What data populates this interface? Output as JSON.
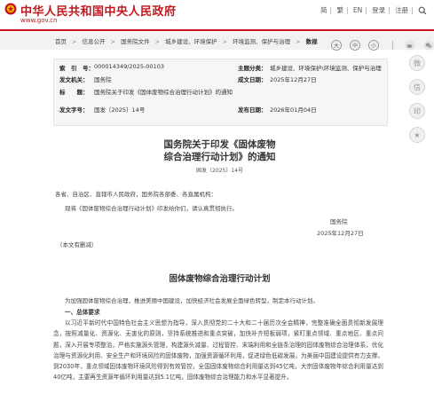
{
  "header": {
    "site_title": "中华人民共和国中央人民政府",
    "site_url": "www.gov.cn",
    "top_links": [
      "简",
      "繁",
      "EN",
      "登录",
      "注册"
    ]
  },
  "breadcrumb": {
    "items": [
      "首页",
      "信息公开",
      "国务院文件",
      "城乡建设、环境保护",
      "环境监测、保护与治理"
    ],
    "current": "数视"
  },
  "meta": {
    "rows": [
      {
        "label": "索　引　号：",
        "value": "000014349/2025-00103",
        "label2": "主题分类：",
        "value2": "城乡建设、环境保护\\环境监测、保护与治理"
      },
      {
        "label": "发文机关：",
        "value": "国务院",
        "label2": "成文日期：",
        "value2": "2025年12月27日"
      },
      {
        "label": "标　　题：",
        "value": "国务院关于印发《固体废物综合治理行动计划》的通知"
      },
      {
        "label": "发文字号：",
        "value": "国发〔2025〕14号",
        "label2": "发布日期：",
        "value2": "2026年01月04日"
      }
    ]
  },
  "article": {
    "title_line1": "国务院关于印发《固体废物",
    "title_line2": "综合治理行动计划》的通知",
    "doc_number": "国发〔2025〕14号",
    "greeting": "各省、自治区、直辖市人民政府，国务院各部委、各直属机构：",
    "body": "现将《固体废物综合治理行动计划》印发给你们，请认真贯彻执行。",
    "signer": "国务院",
    "sign_date": "2025年12月27日",
    "public_note": "（本文有删减）"
  },
  "plan": {
    "title": "固体废物综合治理行动计划",
    "intro": "为加强固体废物综合治理，推进美丽中国建设，加快经济社会发展全面绿色转型，制定本行动计划。",
    "section1": "一、总体要求",
    "section1_text": "以习近平新时代中国特色社会主义思想为指导，深入贯彻党的二十大和二十届历次全会精神，完整准确全面贯彻新发展理念，按照减量化、资源化、无害化的原则，坚持系统推进和重点突破，加快补齐短板弱项，紧盯重点领域、重点地区、重点问题，深入开展专项整治，严格实施源头管理，构建源头减量、过程管控、末端利用和全链条治理的固体废物综合治理体系，优化治理与资源化利用、安全生产和环境风险的固体废物，加强资源循环利用，促进绿色低碳发展，为美丽中国建设提供有力支撑。到2030年，重点领域固体废物环境风险得到有效管控，全国固体废物综合利用量达到45亿吨，大宗固体废物年综合利用量达到40亿吨，主要再生资源年循环利用量达到5.1亿吨，固体废物综合治理能力和水平显著提升。"
  },
  "sidebar_icons": [
    "weibo-icon",
    "wechat-icon",
    "print-icon",
    "favorite-icon"
  ],
  "colors": {
    "brand_red": "#c4161c",
    "crumb_bg": "#f2f2f2",
    "meta_bg": "#f5f6f8"
  }
}
